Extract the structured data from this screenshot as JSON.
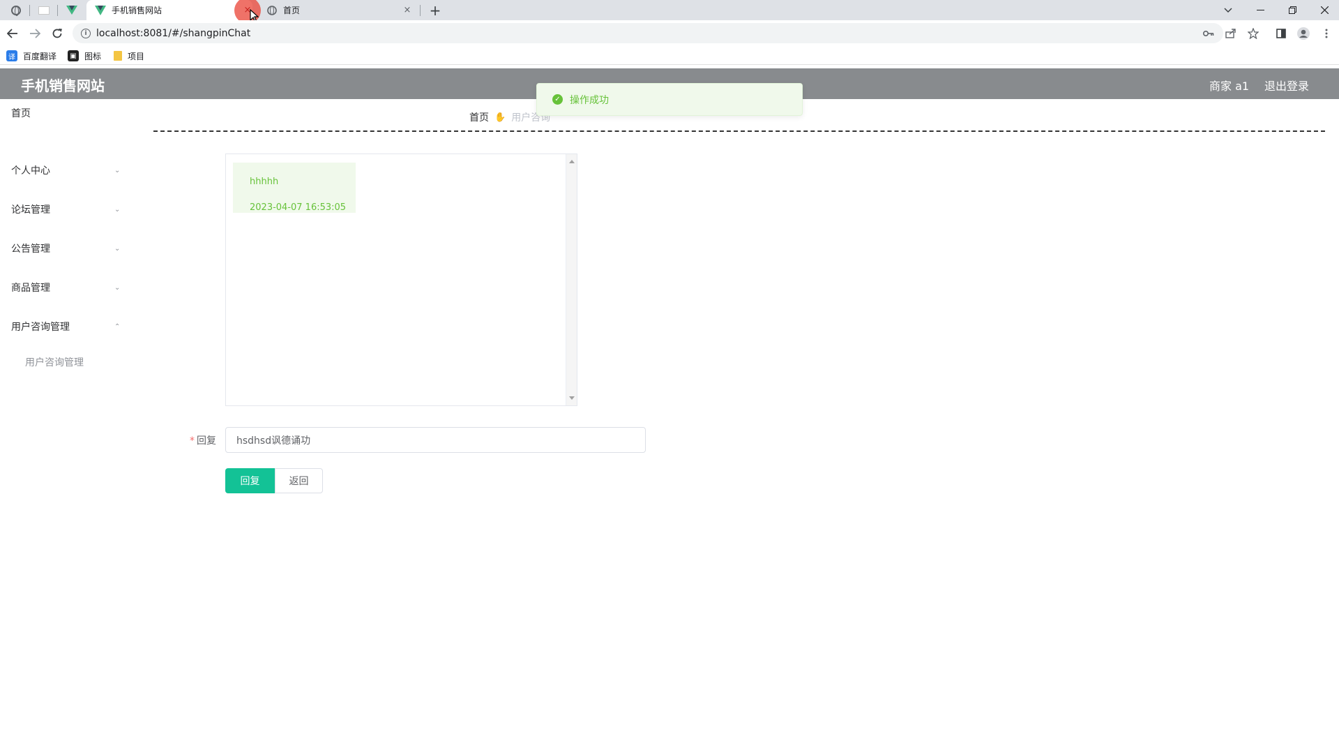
{
  "browser": {
    "tabs": [
      {
        "title": "手机销售网站",
        "active": true
      },
      {
        "title": "首页",
        "active": false
      }
    ],
    "close_glyph": "×",
    "new_tab_glyph": "+",
    "url": "localhost:8081/#/shangpinChat",
    "bookmarks": [
      {
        "label": "百度翻译",
        "icon": "translate-icon",
        "color": "#2b7de9",
        "glyph": "译"
      },
      {
        "label": "图标",
        "icon": "image-icon",
        "color": "#222222",
        "glyph": "▣"
      },
      {
        "label": "项目",
        "icon": "folder-icon",
        "color": "#f4c542",
        "glyph": ""
      }
    ]
  },
  "header": {
    "title": "手机销售网站",
    "user": "商家 a1",
    "logout": "退出登录"
  },
  "sidebar": {
    "items": [
      {
        "label": "首页"
      },
      {
        "label": "个人中心"
      },
      {
        "label": "论坛管理"
      },
      {
        "label": "公告管理"
      },
      {
        "label": "商品管理"
      },
      {
        "label": "用户咨询管理"
      }
    ],
    "subitem": "用户咨询管理"
  },
  "breadcrumb": {
    "home": "首页",
    "current": "用户咨询"
  },
  "chat": {
    "messages": [
      {
        "text": "hhhhh",
        "time": "2023-04-07 16:53:05"
      }
    ]
  },
  "form": {
    "reply_label": "回复",
    "required_mark": "*",
    "reply_value": "hsdhsd讽德诵功",
    "submit_label": "回复",
    "back_label": "返回"
  },
  "toast": {
    "text": "操作成功"
  },
  "colors": {
    "header_bg": "#888b8e",
    "primary": "#13c296",
    "success": "#67c23a"
  }
}
